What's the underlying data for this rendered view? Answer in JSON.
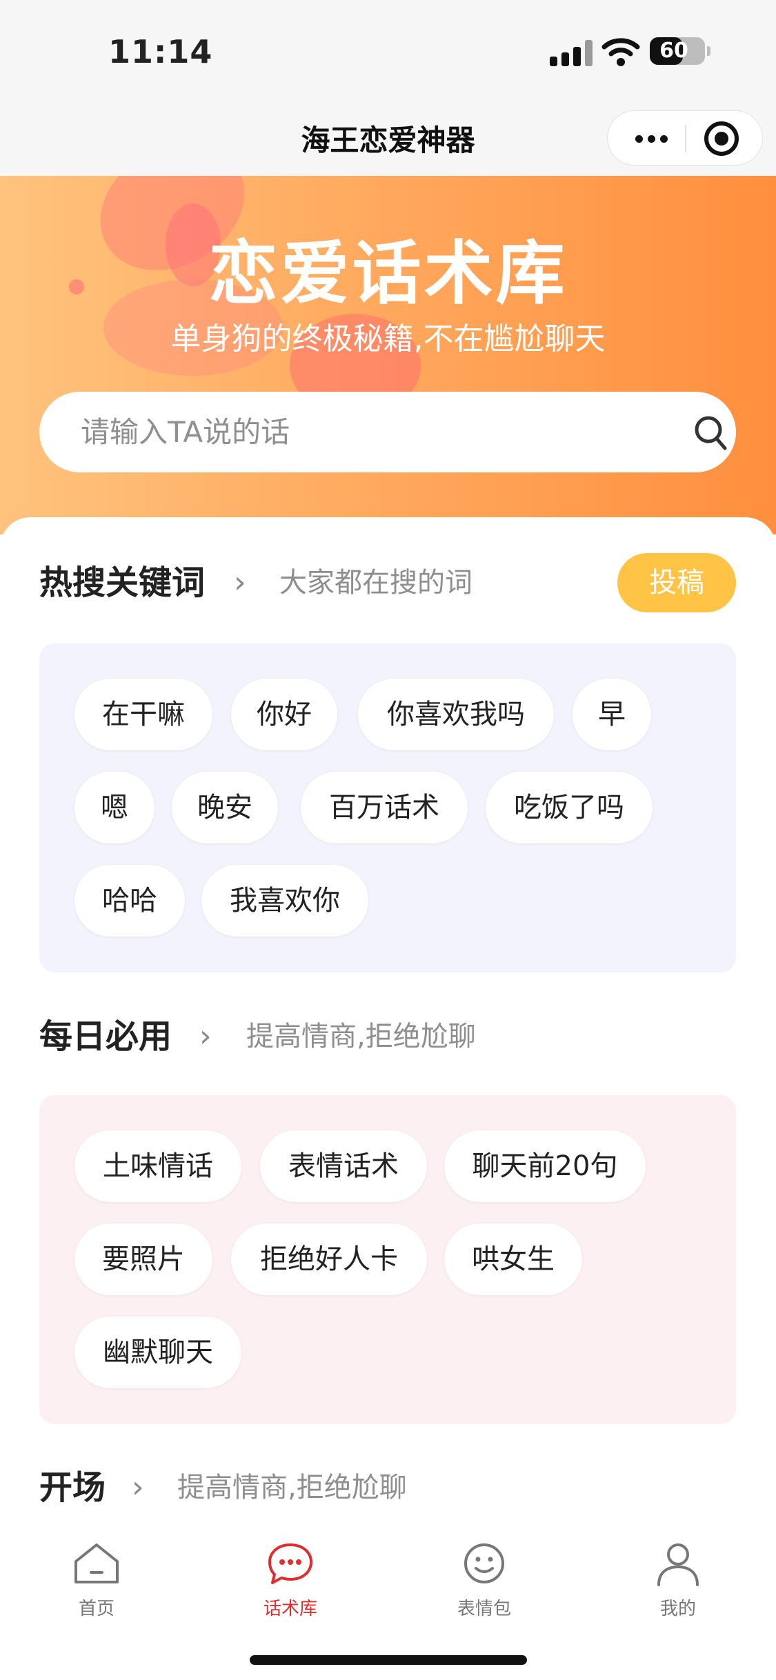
{
  "status_bar": {
    "time": "11:14",
    "battery": "60",
    "battery_level": 0.6
  },
  "nav": {
    "title": "海王恋爱神器"
  },
  "banner": {
    "title": "恋爱话术库",
    "subtitle": "单身狗的终极秘籍,不在尴尬聊天",
    "search_placeholder": "请输入TA说的话"
  },
  "hot": {
    "title": "热搜关键词",
    "subtitle": "大家都在搜的词",
    "submit_label": "投稿",
    "tags": [
      "在干嘛",
      "你好",
      "你喜欢我吗",
      "早",
      "嗯",
      "晚安",
      "百万话术",
      "吃饭了吗",
      "哈哈",
      "我喜欢你"
    ]
  },
  "daily": {
    "title": "每日必用",
    "subtitle": "提高情商,拒绝尬聊",
    "tags": [
      "土味情话",
      "表情话术",
      "聊天前20句",
      "要照片",
      "拒绝好人卡",
      "哄女生",
      "幽默聊天"
    ]
  },
  "opening": {
    "title": "开场",
    "subtitle": "提高情商,拒绝尬聊"
  },
  "tabbar": {
    "items": [
      {
        "label": "首页",
        "icon": "home-icon"
      },
      {
        "label": "话术库",
        "icon": "chat-bubble-icon"
      },
      {
        "label": "表情包",
        "icon": "smiley-icon"
      },
      {
        "label": "我的",
        "icon": "user-icon"
      }
    ],
    "active_index": 1,
    "active_color": "#e02d2d",
    "inactive_color": "#777777"
  },
  "colors": {
    "banner_start": "#ffc37d",
    "banner_end": "#ff8f3e",
    "submit_button": "#ffc445",
    "hot_panel": "#f2f3fc",
    "daily_panel": "#fcf0f3"
  }
}
